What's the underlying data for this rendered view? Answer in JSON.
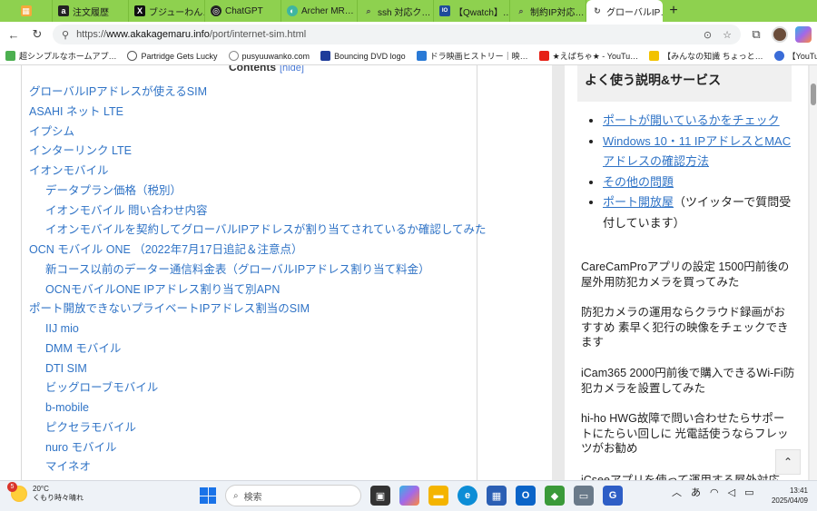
{
  "browser": {
    "tabs": [
      {
        "label": "",
        "favicon": "grid-app-icon",
        "favicon_color": "#f4a93b"
      },
      {
        "label": "注文履歴",
        "favicon": "amazon-icon",
        "favicon_color": "#222222"
      },
      {
        "label": "ブジューわん…",
        "favicon": "x-icon",
        "favicon_color": "#111111"
      },
      {
        "label": "ChatGPT",
        "favicon": "chatgpt-icon",
        "favicon_color": "#222222"
      },
      {
        "label": "Archer MR…",
        "favicon": "tplink-icon",
        "favicon_color": "#3fb5a0"
      },
      {
        "label": "ssh 対応ク…",
        "favicon": "search-icon",
        "favicon_color": "#4a4a4a"
      },
      {
        "label": "【Qwatch】…",
        "favicon": "qwatch-icon",
        "favicon_color": "#1e4c9a"
      },
      {
        "label": "制約IP対応…",
        "favicon": "search-icon",
        "favicon_color": "#4a4a4a"
      },
      {
        "label": "グローバルIP…",
        "favicon": "site-icon",
        "favicon_color": "#4a4a4a",
        "active": true
      }
    ],
    "new_tab_symbol": "+",
    "url_scheme": "https://",
    "url_host": "www.akakagemaru.info",
    "url_path": "/port/internet-sim.html",
    "bookmarks": [
      {
        "label": "超シンプルなホームアプ…",
        "color": "#4caf50"
      },
      {
        "label": "Partridge Gets Lucky",
        "color": "#555555"
      },
      {
        "label": "pusyuuwanko.com",
        "color": "#888888"
      },
      {
        "label": "Bouncing DVD logo",
        "color": "#1e3c9a"
      },
      {
        "label": "ドラ映画ヒストリー｜映…",
        "color": "#2a7ad6"
      },
      {
        "label": "★えばちゃ★ - YouTu…",
        "color": "#e62117"
      },
      {
        "label": "【みんなの知識 ちょっと…",
        "color": "#f2c200"
      },
      {
        "label": "【YouTube】最新順で…",
        "color": "#3a6cd8"
      }
    ]
  },
  "toc": {
    "title": "Contents",
    "hide_label": "[hide]",
    "items": [
      {
        "label": "グローバルIPアドレスが使えるSIM",
        "level": 1
      },
      {
        "label": "ASAHI ネット LTE",
        "level": 1
      },
      {
        "label": "イプシム",
        "level": 1
      },
      {
        "label": "インターリンク LTE",
        "level": 1
      },
      {
        "label": "イオンモバイル",
        "level": 1
      },
      {
        "label": "データプラン価格（税別）",
        "level": 2
      },
      {
        "label": "イオンモバイル 問い合わせ内容",
        "level": 2
      },
      {
        "label": "イオンモバイルを契約してグローバルIPアドレスが割り当てされているか確認してみた",
        "level": 2
      },
      {
        "label": "OCN モバイル ONE （2022年7月17日追記＆注意点）",
        "level": 1
      },
      {
        "label": "新コース以前のデーター通信料金表（グローバルIPアドレス割り当て料金）",
        "level": 2
      },
      {
        "label": "OCNモバイルONE IPアドレス割り当て別APN",
        "level": 2
      },
      {
        "label": "ポート開放できないプライベートIPアドレス割当のSIM",
        "level": 1
      },
      {
        "label": "IIJ mio",
        "level": 2
      },
      {
        "label": "DMM モバイル",
        "level": 2
      },
      {
        "label": "DTI SIM",
        "level": 2
      },
      {
        "label": "ビッグローブモバイル",
        "level": 2
      },
      {
        "label": "b-mobile",
        "level": 2
      },
      {
        "label": "ピクセラモバイル",
        "level": 2
      },
      {
        "label": "nuro モバイル",
        "level": 2
      },
      {
        "label": "マイネオ",
        "level": 2
      }
    ]
  },
  "sidebar": {
    "services_title": "よく使う説明&サービス",
    "services": [
      {
        "link": "ポートが開いているかをチェック",
        "suffix": ""
      },
      {
        "link": "Windows 10・11 IPアドレスとMACアドレスの確認方法",
        "suffix": ""
      },
      {
        "link": "その他の問題",
        "suffix": ""
      },
      {
        "link": "ポート開放屋",
        "suffix": "（ツイッターで質問受付しています）"
      }
    ],
    "articles": [
      "CareCamProアプリの設定 1500円前後の屋外用防犯カメラを買ってみた",
      "防犯カメラの運用ならクラウド録画がおすすめ 素早く犯行の映像をチェックできます",
      "iCam365 2000円前後で購入できるWi-Fi防犯カメラを設置してみた",
      "hi-ho HWG故障で問い合わせたらサポートにたらい回しに 光電話使うならフレッツがお勧め",
      "iCseeアプリを使って運用する屋外対応"
    ],
    "scroll_top_symbol": "⌃"
  },
  "taskbar": {
    "weather_temp": "20°C",
    "weather_desc": "くもり時々晴れ",
    "weather_badge": "5",
    "search_placeholder": "検索",
    "ime": "あ",
    "time": "13:41",
    "date": "2025/04/09"
  }
}
